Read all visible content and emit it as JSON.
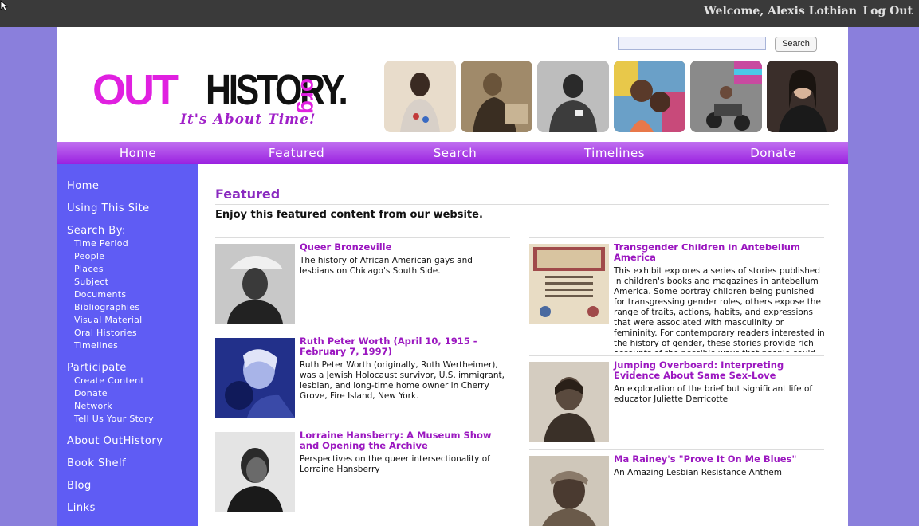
{
  "topbar": {
    "welcome": "Welcome, Alexis Lothian",
    "logout": "Log Out"
  },
  "search": {
    "button": "Search",
    "placeholder": ""
  },
  "logo": {
    "out": "OUT",
    "history": "HISTORY.",
    "org": "org",
    "tagline": "It's About Time!"
  },
  "nav": [
    "Home",
    "Featured",
    "Search",
    "Timelines",
    "Donate"
  ],
  "sidebar": {
    "home": "Home",
    "using": "Using This Site",
    "search_by": "Search By:",
    "search_items": [
      "Time Period",
      "People",
      "Places",
      "Subject",
      "Documents",
      "Bibliographies",
      "Visual Material",
      "Oral Histories",
      "Timelines"
    ],
    "participate": "Participate",
    "participate_items": [
      "Create Content",
      "Donate",
      "Network",
      "Tell Us Your Story"
    ],
    "about": "About OutHistory",
    "bookshelf": "Book Shelf",
    "blog": "Blog",
    "links": "Links"
  },
  "main": {
    "title": "Featured",
    "intro": "Enjoy this featured content from our website.",
    "left_cards": [
      {
        "title": "Queer Bronzeville",
        "desc": "The history of African American gays and lesbians on Chicago's South Side."
      },
      {
        "title": "Ruth Peter Worth (April 10, 1915 - February 7, 1997)",
        "desc": "Ruth Peter Worth (originally, Ruth Wertheimer), was a Jewish Holocaust survivor, U.S. immigrant, lesbian, and long-time home owner in Cherry Grove, Fire Island, New York."
      },
      {
        "title": "Lorraine Hansberry: A Museum Show and Opening the Archive",
        "desc": "Perspectives on the queer intersectionality of Lorraine Hansberry"
      }
    ],
    "right_cards": [
      {
        "title": "Transgender Children in Antebellum America",
        "desc": "This exhibit explores a series of stories published in children's books and magazines in antebellum America. Some portray children being punished for transgressing gender roles, others expose the range of traits, actions, habits, and expressions that were associated with masculinity or femininity. For contemporary readers interested in the history of gender, these stories provide rich accounts of the possible ways that people could live across or"
      },
      {
        "title": "Jumping Overboard: Interpreting Evidence About Same Sex-Love",
        "desc": "An exploration of the brief but significant life of educator Juliette Derricotte"
      },
      {
        "title": "Ma Rainey's \"Prove It On Me Blues\"",
        "desc": "An Amazing Lesbian Resistance Anthem"
      }
    ]
  },
  "colors": {
    "topbar": "#3a3a3a",
    "background": "#8a7fdc",
    "nav": "#9a20e0",
    "sidebar": "#5f5cf4",
    "link": "#9b17c0",
    "accent": "#e020e0"
  }
}
